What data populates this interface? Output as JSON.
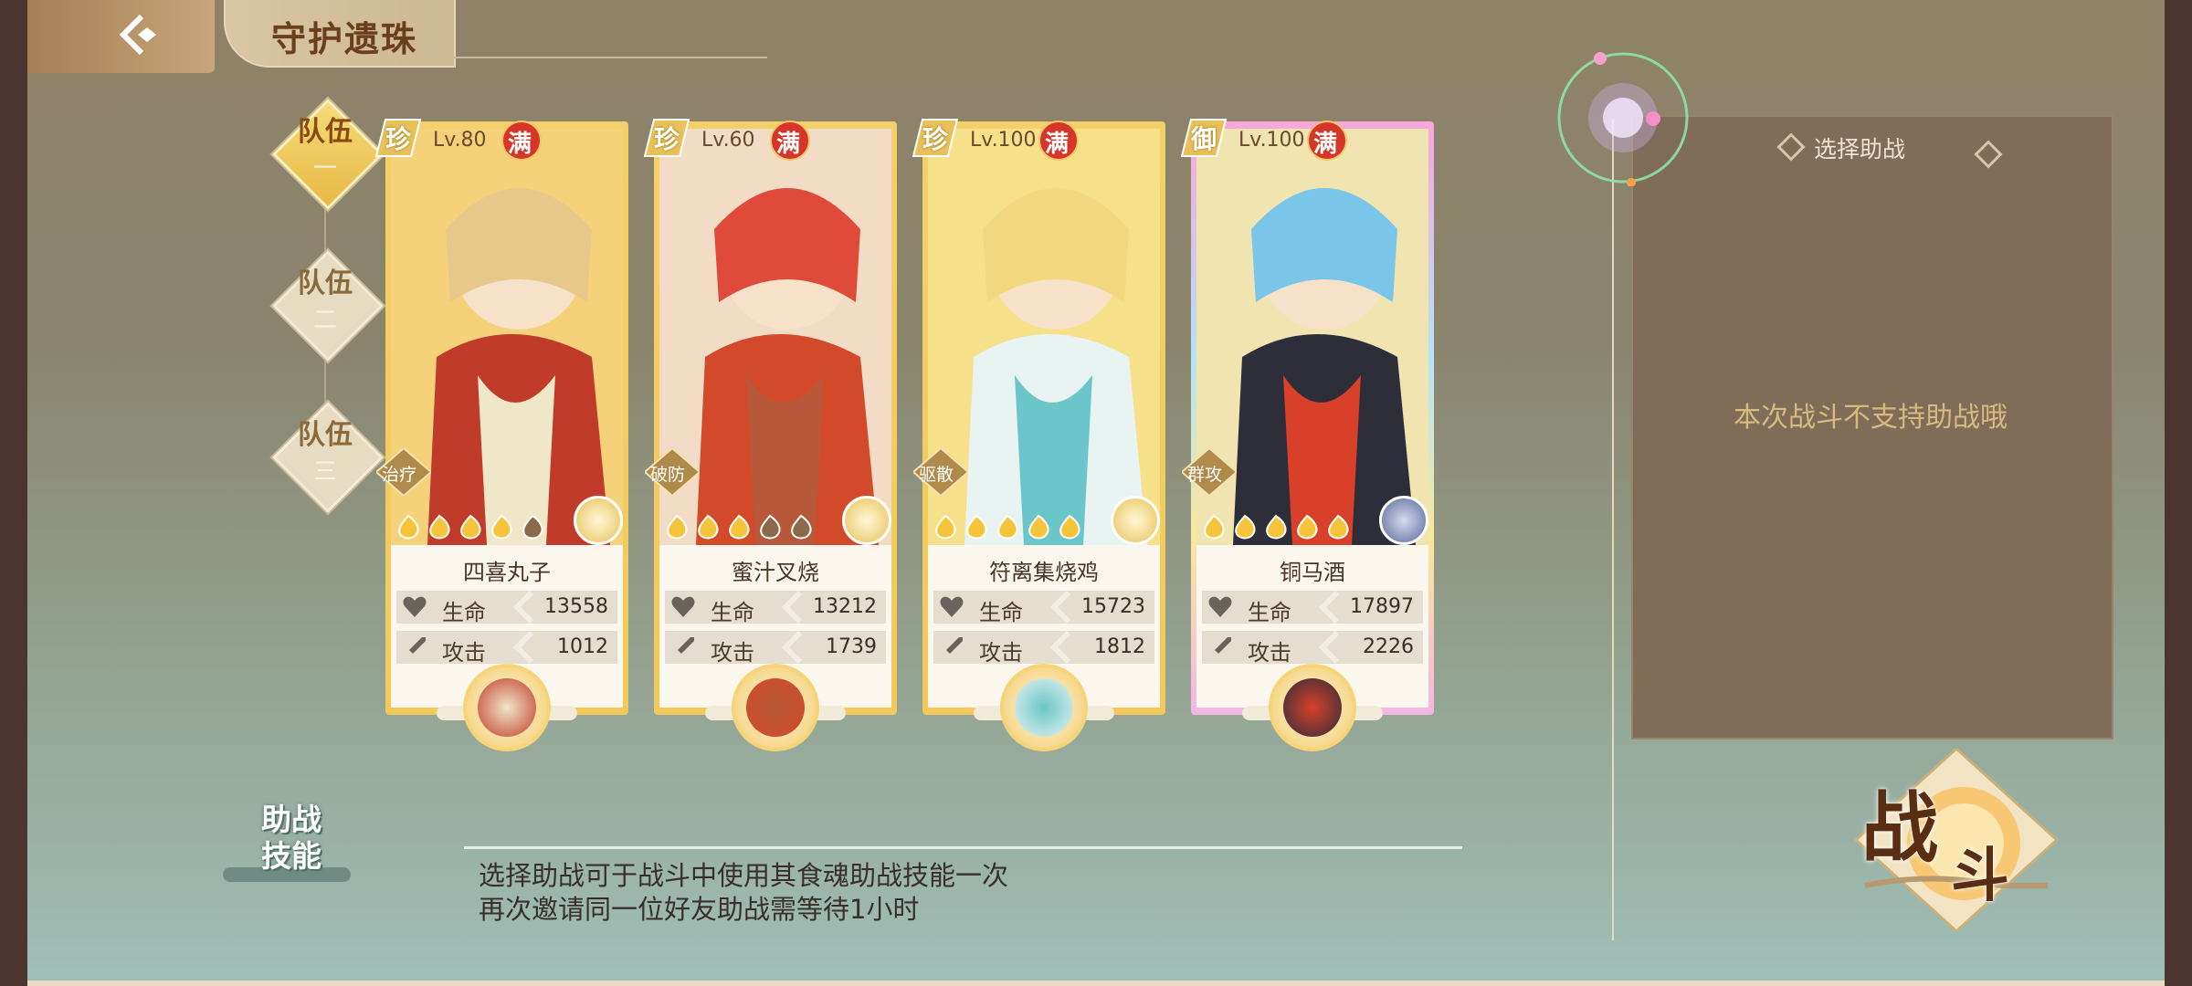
{
  "header": {
    "title": "守护遗珠"
  },
  "teams": [
    {
      "label": "队伍",
      "num": "一",
      "active": true
    },
    {
      "label": "队伍",
      "num": "二",
      "active": false
    },
    {
      "label": "队伍",
      "num": "三",
      "active": false
    }
  ],
  "cards": [
    {
      "rarity": "珍",
      "level": "Lv.80",
      "full": "满",
      "role": "治疗",
      "name": "四喜丸子",
      "hp_label": "生命",
      "hp": "13558",
      "atk_label": "攻击",
      "atk": "1012",
      "stars_lit": 4,
      "stars_total": 5
    },
    {
      "rarity": "珍",
      "level": "Lv.60",
      "full": "满",
      "role": "破防",
      "name": "蜜汁叉烧",
      "hp_label": "生命",
      "hp": "13212",
      "atk_label": "攻击",
      "atk": "1739",
      "stars_lit": 3,
      "stars_total": 5
    },
    {
      "rarity": "珍",
      "level": "Lv.100",
      "full": "满",
      "role": "驱散",
      "name": "符离集烧鸡",
      "hp_label": "生命",
      "hp": "15723",
      "atk_label": "攻击",
      "atk": "1812",
      "stars_lit": 5,
      "stars_total": 5
    },
    {
      "rarity": "御",
      "level": "Lv.100",
      "full": "满",
      "role": "群攻",
      "name": "铜马酒",
      "hp_label": "生命",
      "hp": "17897",
      "atk_label": "攻击",
      "atk": "2226",
      "stars_lit": 5,
      "stars_total": 5
    }
  ],
  "assist": {
    "title": "选择助战",
    "message": "本次战斗不支持助战哦"
  },
  "skill": {
    "tag_line1": "助战",
    "tag_line2": "技能",
    "help_line1": "选择助战可于战斗中使用其食魂助战技能一次",
    "help_line2": "再次邀请同一位好友助战需等待1小时"
  },
  "fight": {
    "label_1": "战",
    "label_2": "斗"
  },
  "colors": {
    "gold_frame": "#f4d06a",
    "panel_brown": "#7f6d58",
    "assist_msg": "#d8b980"
  }
}
